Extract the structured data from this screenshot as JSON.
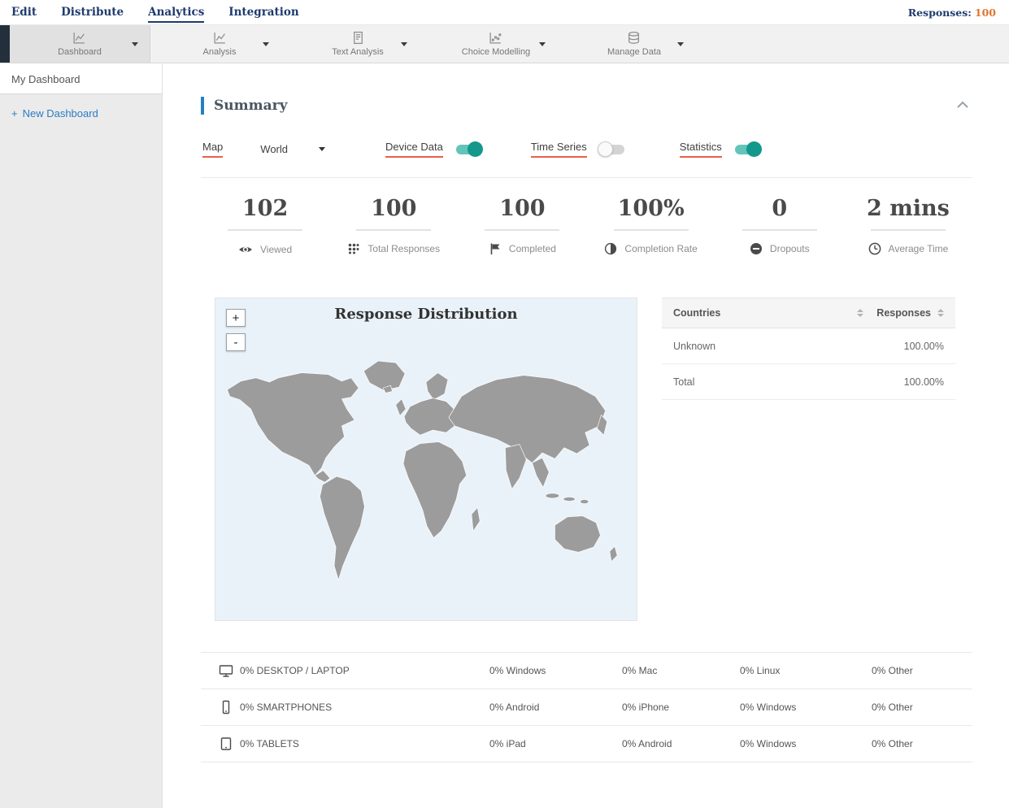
{
  "nav": {
    "items": [
      {
        "label": "Edit",
        "active": false
      },
      {
        "label": "Distribute",
        "active": false
      },
      {
        "label": "Analytics",
        "active": true
      },
      {
        "label": "Integration",
        "active": false
      }
    ],
    "responses_label": "Responses:",
    "responses_value": "100"
  },
  "toolbar": {
    "items": [
      {
        "label": "Dashboard",
        "icon": "line-chart-icon",
        "active": true
      },
      {
        "label": "Analysis",
        "icon": "line-chart-icon",
        "active": false
      },
      {
        "label": "Text Analysis",
        "icon": "text-analysis-icon",
        "active": false
      },
      {
        "label": "Choice Modelling",
        "icon": "choice-modelling-icon",
        "active": false
      },
      {
        "label": "Manage Data",
        "icon": "database-icon",
        "active": false
      }
    ]
  },
  "sidebar": {
    "active_item": "My Dashboard",
    "plus": "+",
    "new_dashboard": "New Dashboard"
  },
  "summary": {
    "title": "Summary",
    "controls": {
      "map_label": "Map",
      "map_value": "World",
      "device_data_label": "Device Data",
      "device_data_on": true,
      "time_series_label": "Time Series",
      "time_series_on": false,
      "statistics_label": "Statistics",
      "statistics_on": true
    },
    "stats": [
      {
        "value": "102",
        "label": "Viewed",
        "icon": "eye-icon"
      },
      {
        "value": "100",
        "label": "Total Responses",
        "icon": "dots-grid-icon"
      },
      {
        "value": "100",
        "label": "Completed",
        "icon": "flag-icon"
      },
      {
        "value": "100%",
        "label": "Completion Rate",
        "icon": "half-circle-icon"
      },
      {
        "value": "0",
        "label": "Dropouts",
        "icon": "minus-circle-icon"
      },
      {
        "value": "2 mins",
        "label": "Average Time",
        "icon": "clock-icon"
      }
    ],
    "map": {
      "title": "Response Distribution",
      "zoom_in": "+",
      "zoom_out": "-"
    },
    "countries_table": {
      "col1": "Countries",
      "col2": "Responses",
      "rows": [
        {
          "name": "Unknown",
          "value": "100.00%"
        },
        {
          "name": "Total",
          "value": "100.00%"
        }
      ]
    },
    "devices": [
      {
        "icon": "desktop-icon",
        "label": "0% DESKTOP / LAPTOP",
        "cols": [
          "0% Windows",
          "0% Mac",
          "0% Linux",
          "0% Other"
        ]
      },
      {
        "icon": "smartphone-icon",
        "label": "0% SMARTPHONES",
        "cols": [
          "0% Android",
          "0% iPhone",
          "0% Windows",
          "0% Other"
        ]
      },
      {
        "icon": "tablet-icon",
        "label": "0% TABLETS",
        "cols": [
          "0% iPad",
          "0% Android",
          "0% Windows",
          "0% Other"
        ]
      }
    ]
  },
  "colors": {
    "navy": "#1e3a6d",
    "accent_blue": "#2380c2",
    "accent_teal": "#14988b",
    "accent_red": "#e8604c",
    "map_land": "#9c9c9c",
    "map_ocean": "#eaf2f9"
  }
}
